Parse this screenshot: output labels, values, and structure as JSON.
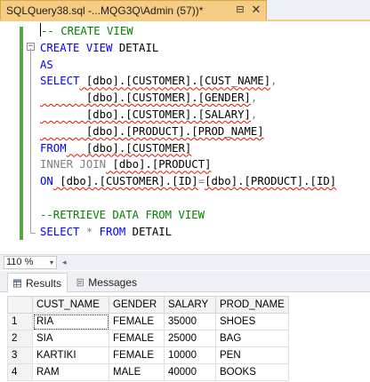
{
  "tab": {
    "title": "SQLQuery38.sql -...MQG3Q\\Admin (57))*",
    "pin": "⊟",
    "close": "✕"
  },
  "editor": {
    "lines": [
      {
        "segments": [
          {
            "t": "-- CREATE VIEW",
            "c": "cm"
          }
        ],
        "indent": 0
      },
      {
        "segments": [
          {
            "t": "CREATE VIEW",
            "c": "kw"
          },
          {
            "t": " DETAIL",
            "c": "tx"
          }
        ],
        "indent": 0
      },
      {
        "segments": [
          {
            "t": "AS",
            "c": "kw"
          }
        ],
        "indent": 0
      },
      {
        "segments": [
          {
            "t": "SELECT",
            "c": "kw"
          },
          {
            "t": " [dbo].[CUSTOMER].[CUST_NAME]",
            "c": "tx",
            "sq": true
          },
          {
            "t": ",",
            "c": "gray"
          }
        ]
      },
      {
        "segments": [
          {
            "t": "       [dbo].[CUSTOMER].[GENDER]",
            "c": "tx",
            "sq": true
          },
          {
            "t": ",",
            "c": "gray"
          }
        ]
      },
      {
        "segments": [
          {
            "t": "       [dbo].[CUSTOMER].[SALARY]",
            "c": "tx",
            "sq": true
          },
          {
            "t": ",",
            "c": "gray"
          }
        ]
      },
      {
        "segments": [
          {
            "t": "       [dbo].[PRODUCT].[PROD_NAME]",
            "c": "tx",
            "sq": true
          }
        ]
      },
      {
        "segments": [
          {
            "t": "FROM",
            "c": "kw"
          },
          {
            "t": "   [dbo].[CUSTOMER]",
            "c": "tx",
            "sq": true
          }
        ]
      },
      {
        "segments": [
          {
            "t": "INNER JOIN",
            "c": "gray"
          },
          {
            "t": " [dbo].[PRODUCT]",
            "c": "tx",
            "sq": true
          }
        ]
      },
      {
        "segments": [
          {
            "t": "ON",
            "c": "kw"
          },
          {
            "t": " [dbo].[CUSTOMER].[ID]",
            "c": "tx",
            "sq": true
          },
          {
            "t": "=",
            "c": "gray"
          },
          {
            "t": "[dbo].[PRODUCT].[ID]",
            "c": "tx",
            "sq": true
          }
        ]
      },
      {
        "segments": [
          {
            "t": "",
            "c": "tx"
          }
        ]
      },
      {
        "segments": [
          {
            "t": "--RETRIEVE DATA FROM VIEW",
            "c": "cm"
          }
        ]
      },
      {
        "segments": [
          {
            "t": "SELECT",
            "c": "kw"
          },
          {
            "t": " * ",
            "c": "gray"
          },
          {
            "t": "FROM",
            "c": "kw"
          },
          {
            "t": " DETAIL",
            "c": "tx"
          }
        ]
      }
    ]
  },
  "zoom": {
    "value": "110 %",
    "arrow": "▾"
  },
  "results_tabs": {
    "results": "Results",
    "messages": "Messages"
  },
  "grid": {
    "columns": [
      "CUST_NAME",
      "GENDER",
      "SALARY",
      "PROD_NAME"
    ],
    "rows": [
      {
        "n": "1",
        "cells": [
          "RIA",
          "FEMALE",
          "35000",
          "SHOES"
        ]
      },
      {
        "n": "2",
        "cells": [
          "SIA",
          "FEMALE",
          "25000",
          "BAG"
        ]
      },
      {
        "n": "3",
        "cells": [
          "KARTIKI",
          "FEMALE",
          "10000",
          "PEN"
        ]
      },
      {
        "n": "4",
        "cells": [
          "RAM",
          "MALE",
          "40000",
          "BOOKS"
        ]
      }
    ]
  },
  "colors": {
    "tab_active": "#f5cc84",
    "keyword": "#0000ff",
    "comment": "#008000",
    "change_bar": "#57a64a"
  }
}
